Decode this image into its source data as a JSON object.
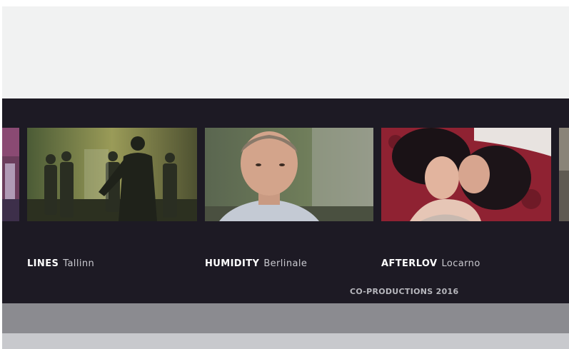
{
  "films": [
    {
      "title": "LINES",
      "festival": "Tallinn",
      "image_icon": "film-still-riot-icon"
    },
    {
      "title": "HUMIDITY",
      "festival": "Berlinale",
      "image_icon": "film-still-portrait-icon"
    },
    {
      "title": "AFTERLOV",
      "festival": "Locarno",
      "image_icon": "film-still-couple-icon"
    }
  ],
  "footer": {
    "label": "CO-PRODUCTIONS 2016"
  },
  "colors": {
    "panel": "#1d1a24",
    "top_band": "#f1f2f2",
    "gray_band": "#8b8b90",
    "light_band": "#c8c9cd"
  }
}
